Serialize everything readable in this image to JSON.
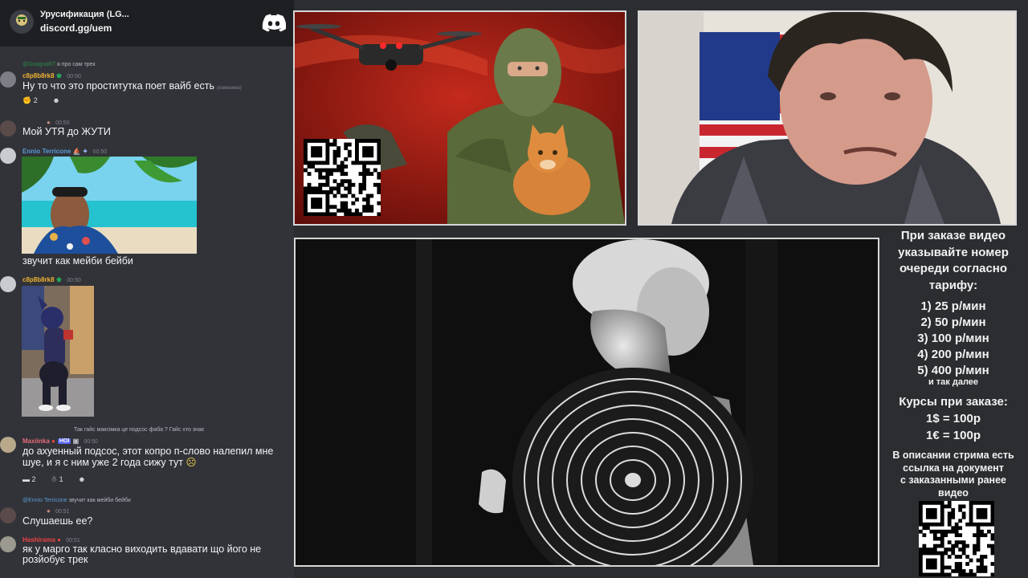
{
  "server": {
    "name": "Урусификация (LG...",
    "invite": "discord.gg/uem"
  },
  "messages": [
    {
      "reply_author": "@GraignaRT",
      "reply_text": "я про сам трек",
      "author": "c8p8b8rk8",
      "time": "00:50",
      "text": "Ну то что это проститутка поет вайб есть",
      "edited": "(изменено)",
      "reactions": [
        "2",
        "☻"
      ]
    },
    {
      "time": "00:50",
      "text": "Мой УТЯ до ЖУТИ"
    },
    {
      "author": "Ennio Terricone",
      "time": "00:50",
      "caption": "звучит как мейби бейби"
    },
    {
      "author": "c8p8b8rk8",
      "time": "00:50"
    },
    {
      "reply_text": "Так гайс максімка це подсос фаба ? Гайс хто знає",
      "author": "Maxiinka",
      "badge": "HOI",
      "time": "00:50",
      "text": "до ахуенный подсос, этот копро п-слово налепил мне шуе, и я с ним уже 2 года сижу тут",
      "reactions": [
        "2",
        "1",
        "☻"
      ]
    },
    {
      "reply_author": "@Ennio Terricone",
      "reply_text": "звучит как мейби бейби",
      "time": "00:51",
      "text": "Слушаешь ее?"
    },
    {
      "author": "Hashirama",
      "time": "00:51",
      "text": "як у марго так класно виходить вдавати що його не розйобує трек"
    }
  ],
  "info": {
    "title_lines": [
      "При заказе видео",
      "указывайте номер",
      "очереди согласно",
      "тарифу:"
    ],
    "tariffs": [
      "1) 25 р/мин",
      "2) 50 р/мин",
      "3) 100 р/мин",
      "4) 200 р/мин",
      "5) 400 р/мин"
    ],
    "tariffs_more": "и так далее",
    "course_title": "Курсы при заказе:",
    "course_rates": [
      "1$ = 100р",
      "1€ = 100р"
    ],
    "desc_lines": [
      "В описании стрима есть",
      "ссылка на документ",
      "с заказанными ранее",
      "видео"
    ]
  },
  "colors": {
    "accent_green": "#23a55a",
    "author_yellow": "#f0b232",
    "author_blue": "#5b9bd5",
    "author_pink": "#e56b7a",
    "author_red": "#ed4245"
  }
}
